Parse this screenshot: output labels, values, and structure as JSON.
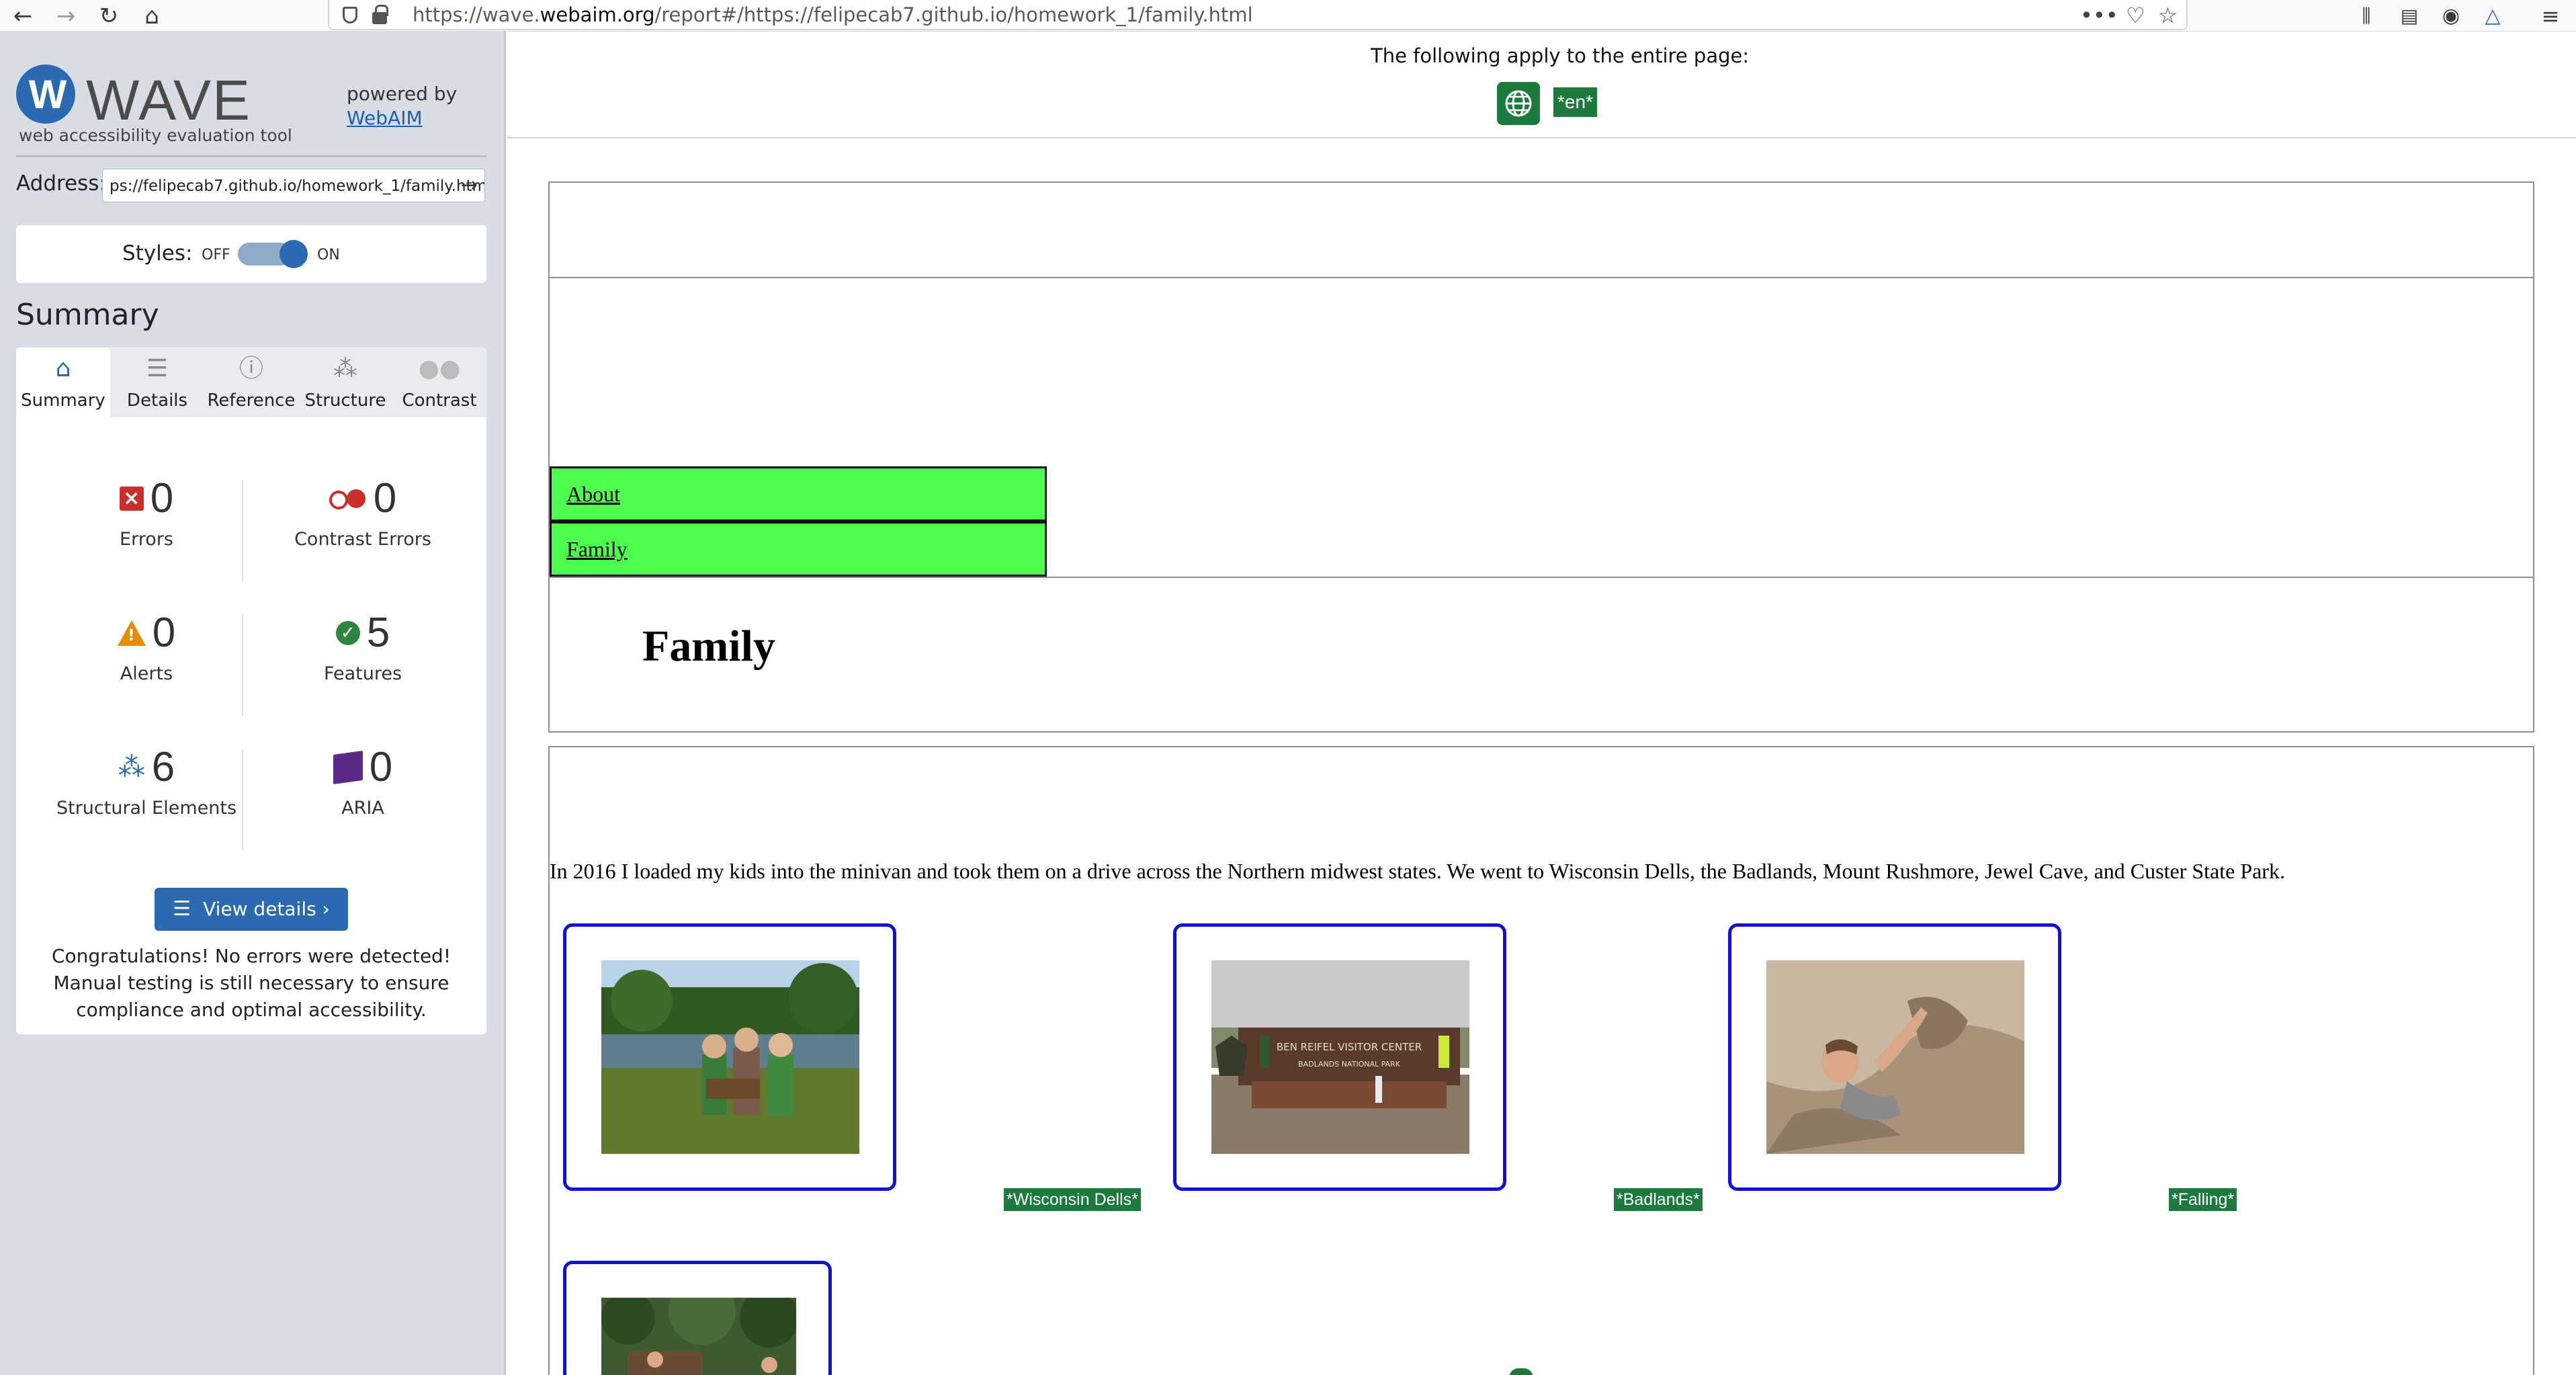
{
  "browser": {
    "url_prefix": "https://wave.",
    "url_domain": "webaim.org",
    "url_suffix": "/report#/https://felipecab7.github.io/homework_1/family.html"
  },
  "wave": {
    "logo_letter": "W",
    "logo_text": "WAVE",
    "tagline": "web accessibility evaluation tool",
    "powered_by": "powered by",
    "powered_link": "WebAIM",
    "address_label": "Address:",
    "address_value": "ps://felipecab7.github.io/homework_1/family.html",
    "styles_label": "Styles:",
    "styles_off": "OFF",
    "styles_on": "ON",
    "styles_enabled": true,
    "summary_heading": "Summary",
    "tabs": [
      {
        "label": "Summary",
        "icon": "home-icon",
        "active": true
      },
      {
        "label": "Details",
        "icon": "list-icon",
        "active": false
      },
      {
        "label": "Reference",
        "icon": "info-icon",
        "active": false
      },
      {
        "label": "Structure",
        "icon": "hierarchy-icon",
        "active": false
      },
      {
        "label": "Contrast",
        "icon": "contrast-icon",
        "active": false
      }
    ],
    "stats": {
      "errors": {
        "count": "0",
        "label": "Errors"
      },
      "contrast_errors": {
        "count": "0",
        "label": "Contrast Errors"
      },
      "alerts": {
        "count": "0",
        "label": "Alerts"
      },
      "features": {
        "count": "5",
        "label": "Features"
      },
      "structural": {
        "count": "6",
        "label": "Structural Elements"
      },
      "aria": {
        "count": "0",
        "label": "ARIA"
      }
    },
    "view_details": "View details ›",
    "congrats": "Congratulations! No errors were detected! Manual testing is still necessary to ensure compliance and optimal accessibility."
  },
  "report": {
    "page_note": "The following apply to the entire page:",
    "lang_badge": "*en*",
    "nav": [
      "About",
      "Family"
    ],
    "heading": "Family",
    "paragraph": "In 2016 I loaded my kids into the minivan and took them on a drive across the Northern midwest states. We went to Wisconsin Dells, the Badlands, Mount Rushmore, Jewel Cave, and Custer State Park.",
    "captions": [
      "*Wisconsin Dells*",
      "*Badlands*",
      "*Falling*"
    ],
    "photo_sign_text": [
      "BEN REIFEL VISITOR CENTER",
      "BADLANDS NATIONAL PARK"
    ]
  },
  "colors": {
    "wave_blue": "#2b69b1",
    "nav_green": "#4cff4c",
    "badge_green": "#1c7a3e",
    "figure_border": "#1010d8",
    "error_red": "#c9302c",
    "alert_orange": "#e88b00",
    "aria_purple": "#5b2a86"
  }
}
